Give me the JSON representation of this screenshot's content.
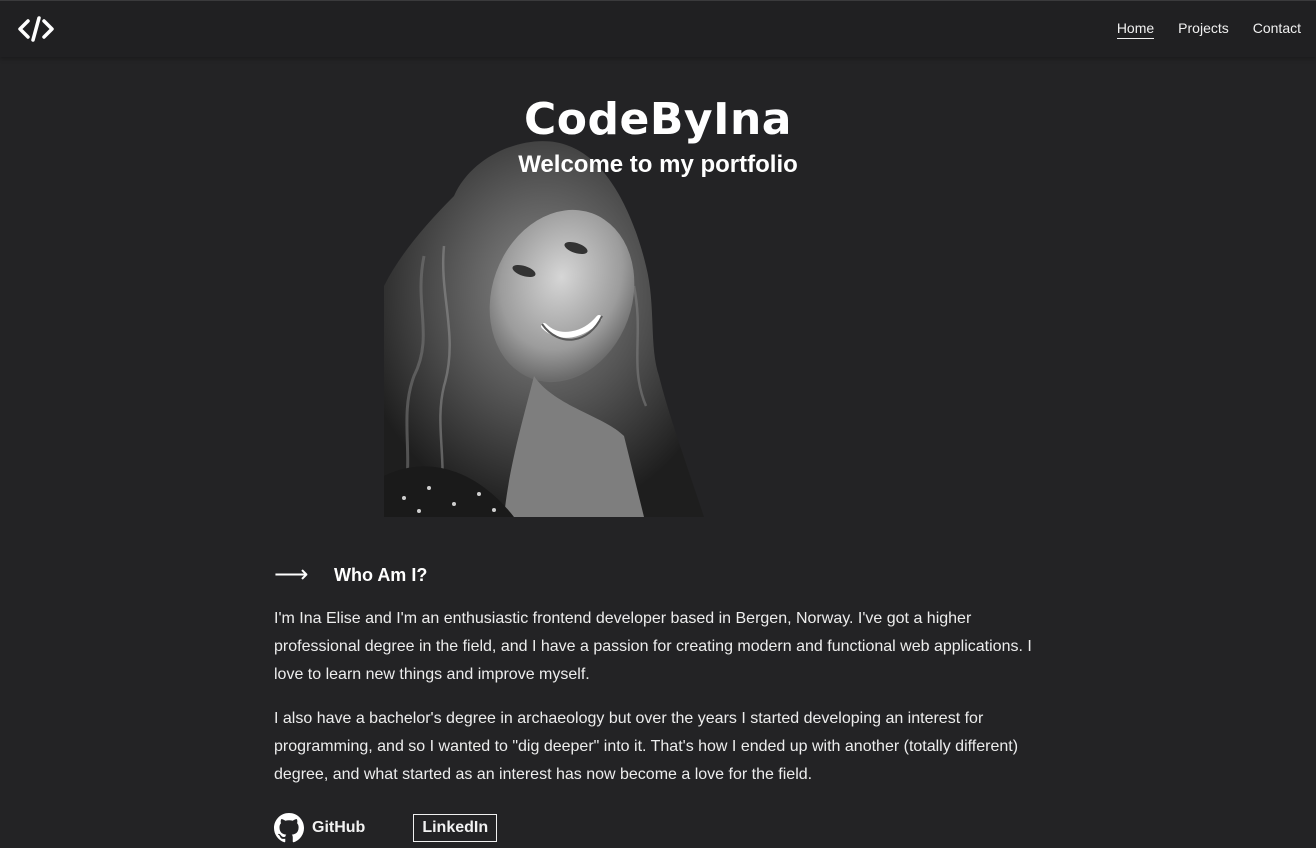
{
  "nav": {
    "logo_icon": "code-brackets-icon",
    "links": [
      {
        "label": "Home",
        "active": true
      },
      {
        "label": "Projects",
        "active": false
      },
      {
        "label": "Contact",
        "active": false
      }
    ]
  },
  "hero": {
    "title": "CodeByIna",
    "subtitle": "Welcome to my portfolio"
  },
  "about": {
    "arrow_icon": "arrow-right-icon",
    "title": "Who Am I?",
    "paragraphs": [
      "I'm Ina Elise and I'm an enthusiastic frontend developer based in Bergen, Norway. I've got a higher professional degree in the field, and I have a passion for creating modern and functional web applications. I love to learn new things and improve myself.",
      "I also have a bachelor's degree in archaeology but over the years I started developing an interest for programming, and so I wanted to \"dig deeper\" into it. That's how I ended up with another (totally different) degree, and what started as an interest has now become a love for the field."
    ]
  },
  "social": {
    "github_label": "GitHub",
    "github_icon": "github-icon",
    "linkedin_label": "LinkedIn"
  },
  "colors": {
    "background": "#232325",
    "nav_background": "#202022",
    "text": "#f2f2f2"
  }
}
